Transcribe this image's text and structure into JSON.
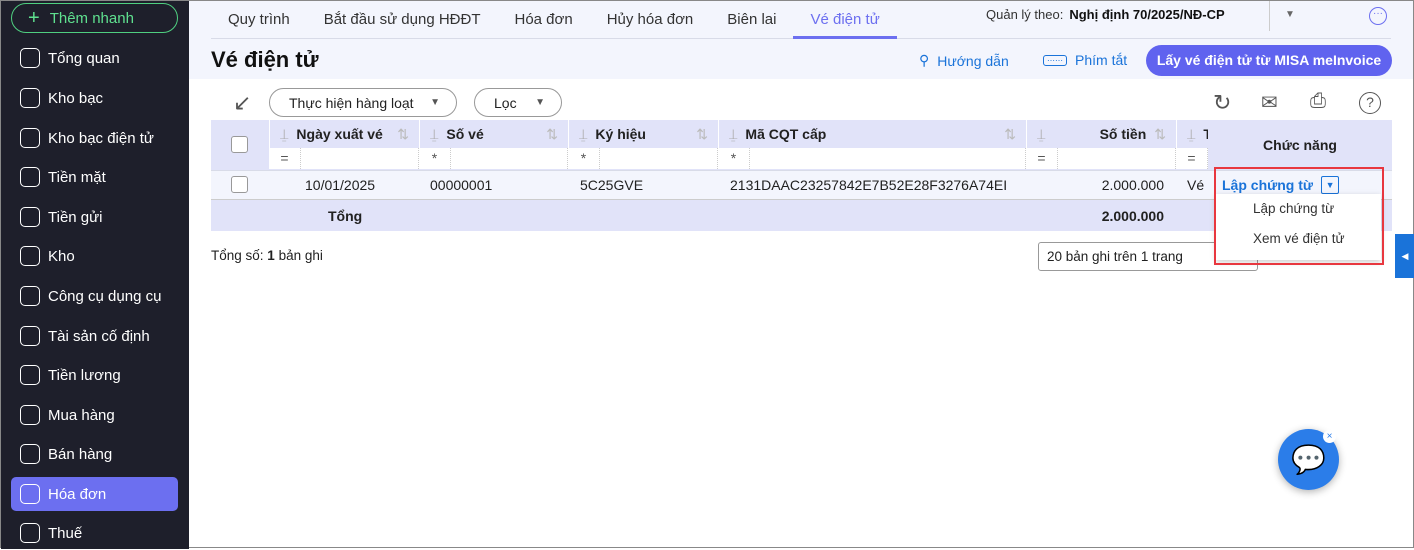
{
  "sidebar": {
    "quick_add": "Thêm nhanh",
    "items": [
      {
        "label": "Tổng quan",
        "icon": "pie-chart-icon"
      },
      {
        "label": "Kho bạc",
        "icon": "treasury-icon"
      },
      {
        "label": "Kho bạc điện tử",
        "icon": "e-treasury-icon"
      },
      {
        "label": "Tiền mặt",
        "icon": "cash-icon"
      },
      {
        "label": "Tiền gửi",
        "icon": "deposit-icon"
      },
      {
        "label": "Kho",
        "icon": "warehouse-icon"
      },
      {
        "label": "Công cụ dụng cụ",
        "icon": "tools-icon"
      },
      {
        "label": "Tài sản cố định",
        "icon": "asset-icon"
      },
      {
        "label": "Tiền lương",
        "icon": "salary-icon"
      },
      {
        "label": "Mua hàng",
        "icon": "cart-icon"
      },
      {
        "label": "Bán hàng",
        "icon": "store-icon"
      },
      {
        "label": "Hóa đơn",
        "icon": "invoice-icon",
        "active": true
      },
      {
        "label": "Thuế",
        "icon": "tax-icon"
      }
    ]
  },
  "tabs": [
    "Quy trình",
    "Bắt đầu sử dụng HĐĐT",
    "Hóa đơn",
    "Hủy hóa đơn",
    "Biên lai",
    "Vé điện tử"
  ],
  "regime": {
    "label": "Quản lý theo:",
    "value": "Nghị định 70/2025/NĐ-CP"
  },
  "page": {
    "title": "Vé điện tử",
    "guide": "Hướng dẫn",
    "shortcuts": "Phím tắt",
    "fetch_button": "Lấy vé điện tử từ MISA meInvoice"
  },
  "toolbar": {
    "batch": "Thực hiện hàng loạt",
    "filter": "Lọc"
  },
  "table": {
    "columns": [
      "Ngày xuất vé",
      "Số vé",
      "Ký hiệu",
      "Mã CQT cấp",
      "Số tiền",
      "T",
      "Chức năng"
    ],
    "filters": [
      "=",
      "*",
      "*",
      "*",
      "=",
      "="
    ],
    "rows": [
      {
        "date": "10/01/2025",
        "number": "00000001",
        "symbol": "5C25GVE",
        "cqt_code": "2131DAAC23257842E7B52E28F3276A74EI",
        "amount": "2.000.000",
        "type": "Vé",
        "action": "Lập chứng từ"
      }
    ],
    "total_label": "Tổng",
    "total_amount": "2.000.000"
  },
  "footer": {
    "total_prefix": "Tổng số:",
    "total_count": "1",
    "total_suffix": "bản ghi",
    "page_size": "20 bản ghi trên 1 trang"
  },
  "dropdown": [
    "Lập chứng từ",
    "Xem vé điện tử"
  ],
  "colors": {
    "accent": "#6c6ff0",
    "link": "#1a73d9",
    "sidebar": "#1e1f2b",
    "highlight": "#e8373f"
  }
}
